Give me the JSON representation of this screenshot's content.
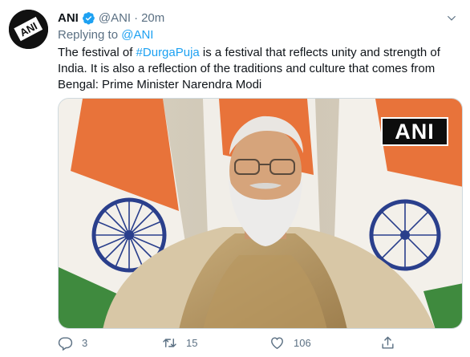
{
  "tweet": {
    "author_name": "ANI",
    "handle": "@ANI",
    "separator": "·",
    "time": "20m",
    "replying_prefix": "Replying to",
    "replying_to": "@ANI",
    "text_before": "The festival of ",
    "hashtag": "#DurgaPuja",
    "text_after": " is a festival that reflects unity and strength of India. It is also a reflection of the traditions and culture that comes from Bengal: Prime Minister Narendra Modi",
    "avatar_text": "ANI",
    "media_watermark": "ANI"
  },
  "actions": {
    "reply_count": "3",
    "retweet_count": "15",
    "like_count": "106"
  },
  "icons": {
    "verified": "verified-badge-icon",
    "more": "chevron-down-icon",
    "reply": "reply-icon",
    "retweet": "retweet-icon",
    "like": "heart-icon",
    "share": "share-icon"
  },
  "colors": {
    "accent": "#1da1f2",
    "secondary_text": "#5b7083",
    "primary_text": "#0f1419"
  }
}
